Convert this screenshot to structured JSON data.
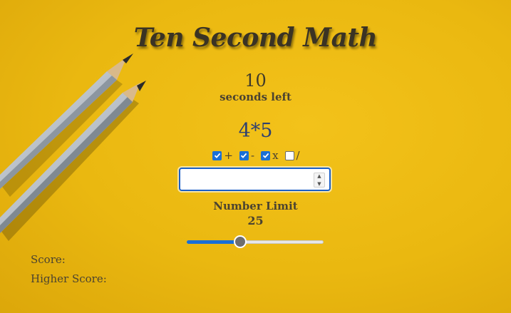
{
  "app": {
    "title": "Ten Second Math"
  },
  "timer": {
    "value": "10",
    "label": "seconds left"
  },
  "problem": {
    "text": "4*5"
  },
  "operators": [
    {
      "label": "+",
      "checked": true
    },
    {
      "label": "-",
      "checked": true
    },
    {
      "label": "x",
      "checked": true
    },
    {
      "label": "/",
      "checked": false
    }
  ],
  "answer": {
    "value": "",
    "placeholder": ""
  },
  "limit": {
    "label": "Number Limit",
    "value": "25",
    "fraction": 0.39
  },
  "score": {
    "label": "Score:"
  },
  "high_score": {
    "label": "Higher Score:"
  },
  "colors": {
    "accent": "#1a6fd6",
    "background": "#eab810"
  }
}
